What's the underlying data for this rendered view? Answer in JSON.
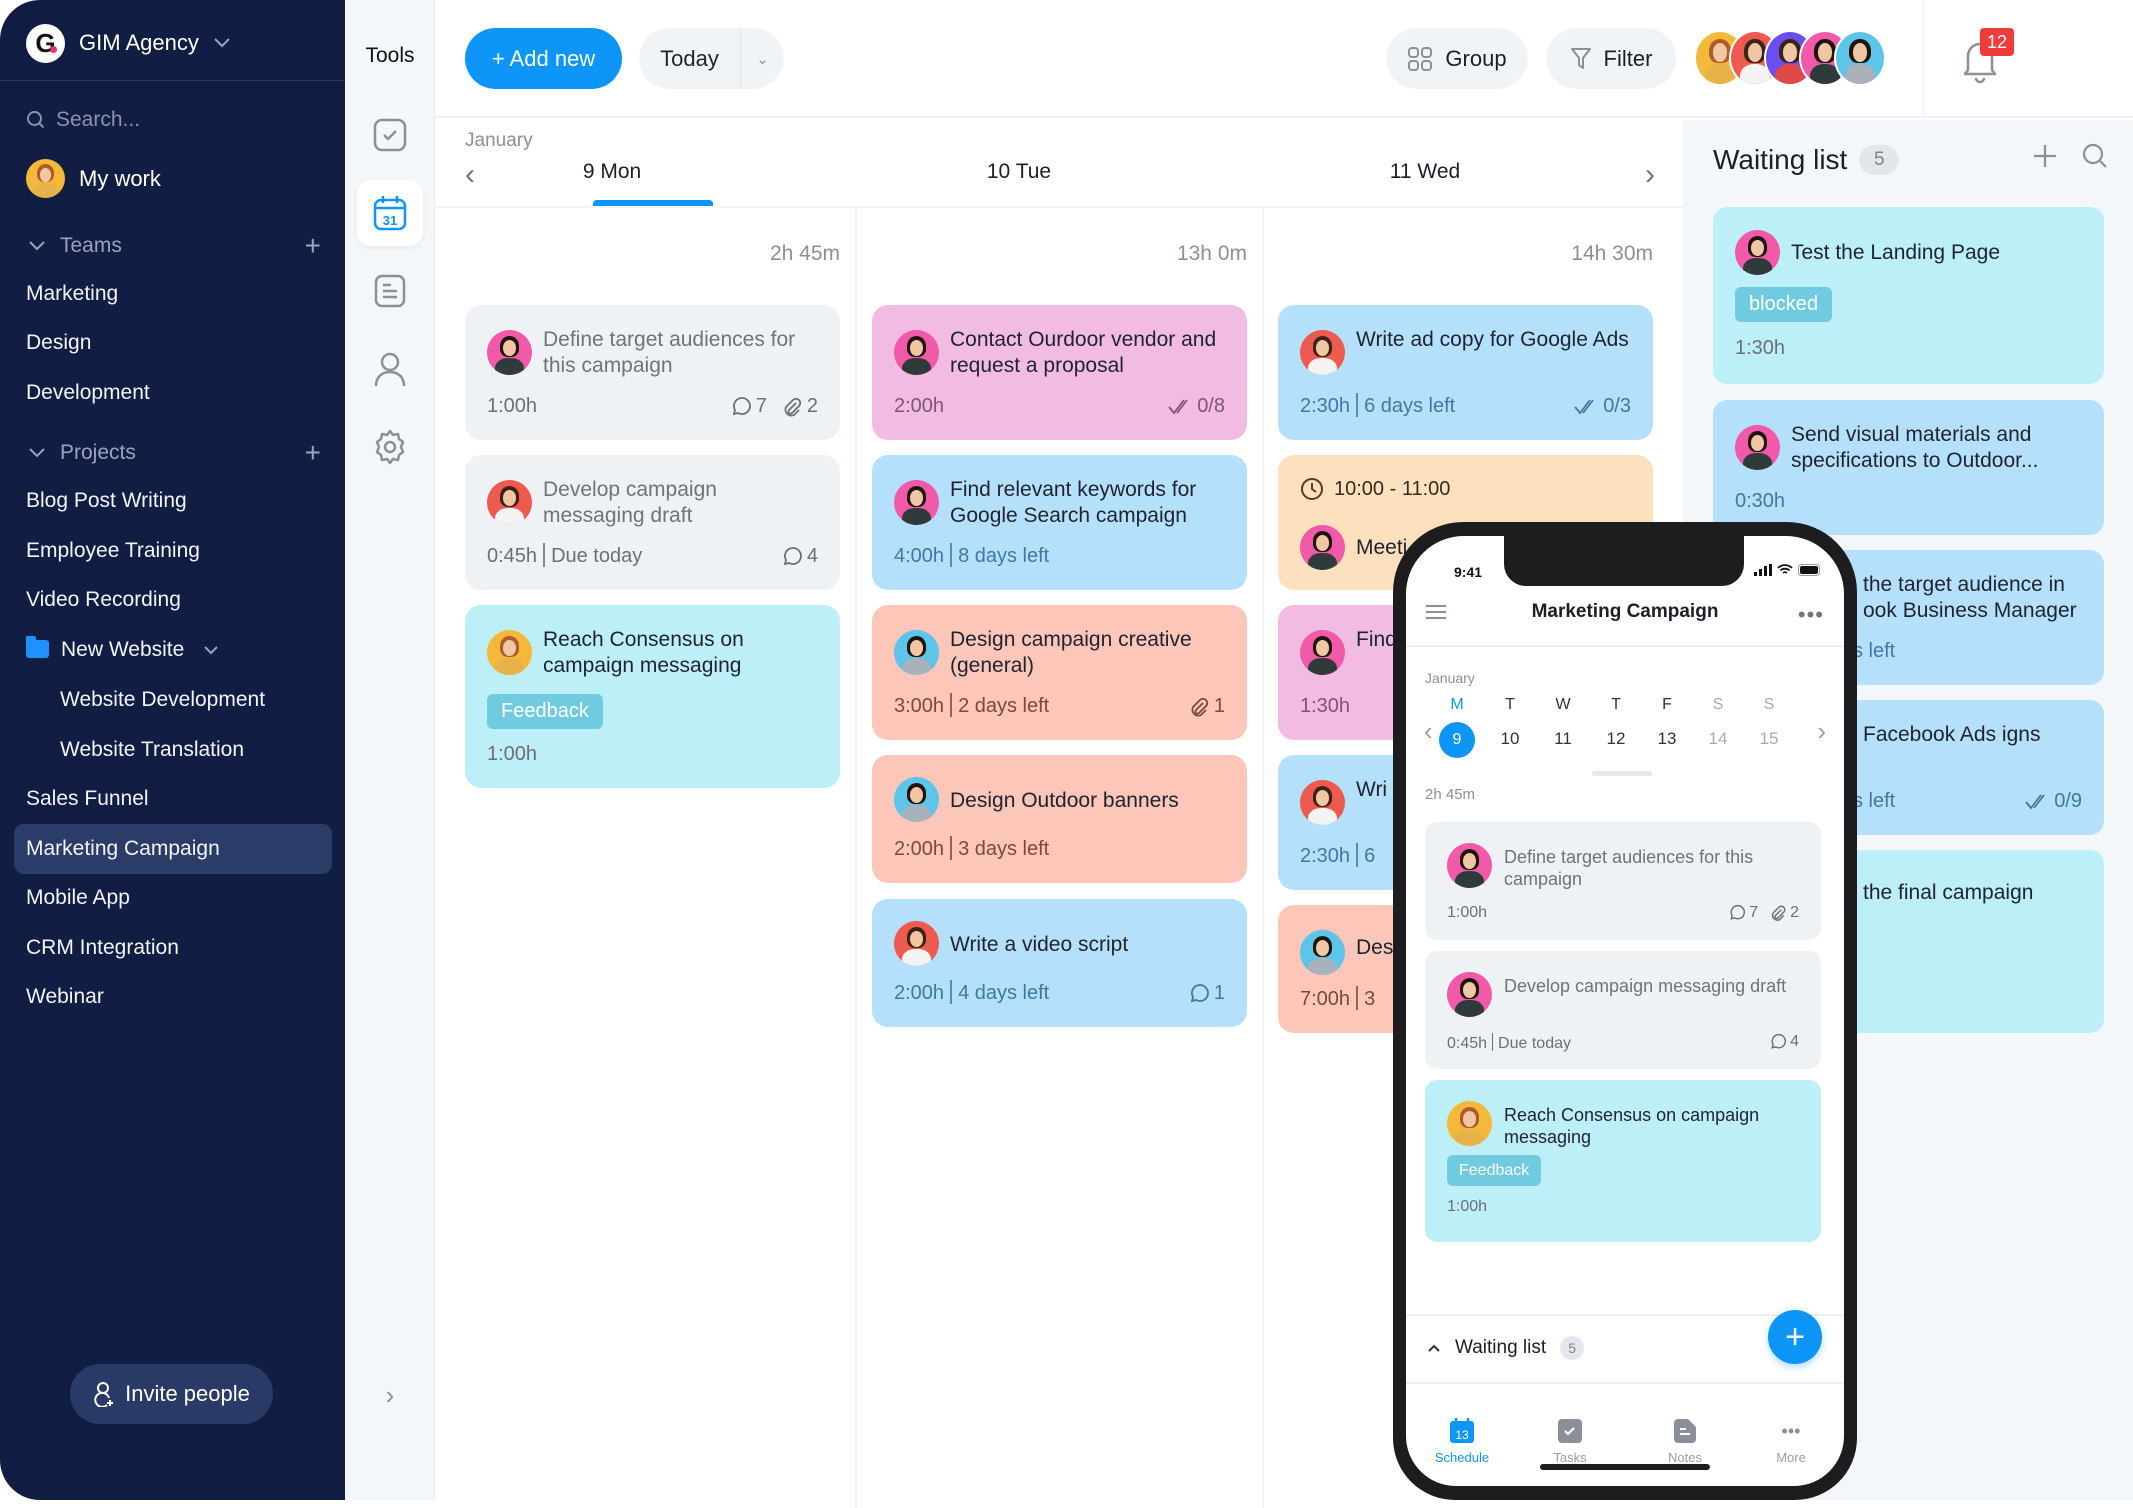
{
  "sidebar": {
    "workspace": "GIM Agency",
    "logo_letter": "G",
    "search_placeholder": "Search...",
    "my_work": "My work",
    "teams_label": "Teams",
    "teams": [
      "Marketing",
      "Design",
      "Development"
    ],
    "projects_label": "Projects",
    "projects": [
      "Blog Post Writing",
      "Employee Training",
      "Video Recording"
    ],
    "folder": {
      "label": "New Website",
      "children": [
        "Website Development",
        "Website Translation"
      ]
    },
    "projects_after": [
      "Sales Funnel",
      "Marketing Campaign",
      "Mobile App",
      "CRM Integration",
      "Webinar"
    ],
    "active_project": "Marketing Campaign",
    "invite": "Invite people"
  },
  "tools": {
    "title": "Tools",
    "items": [
      "tasks-icon",
      "calendar-icon",
      "notes-icon",
      "people-icon",
      "settings-icon"
    ],
    "calendar_day": "31"
  },
  "header": {
    "add_new": "+ Add new",
    "today": "Today",
    "group": "Group",
    "filter": "Filter",
    "notifications": "12"
  },
  "calendar": {
    "month": "January",
    "days": [
      {
        "label": "9 Mon",
        "total": "2h 45m",
        "active": true
      },
      {
        "label": "10 Tue",
        "total": "13h 0m"
      },
      {
        "label": "11 Wed",
        "total": "14h 30m"
      }
    ],
    "columns": [
      [
        {
          "title": "Define target audiences for this campaign",
          "meta": [
            "1:00h"
          ],
          "comments": "7",
          "attachments": "2",
          "color": "gray"
        },
        {
          "title": "Develop campaign messaging draft",
          "meta": [
            "0:45h",
            "Due today"
          ],
          "comments": "4",
          "color": "gray"
        },
        {
          "title": "Reach Consensus on campaign messaging",
          "tag": "Feedback",
          "meta": [
            "1:00h"
          ],
          "color": "cyan"
        }
      ],
      [
        {
          "title": "Contact Ourdoor vendor and request a proposal",
          "meta": [
            "2:00h"
          ],
          "checklist": "0/8",
          "color": "pink"
        },
        {
          "title": "Find relevant keywords for Google Search campaign",
          "meta": [
            "4:00h",
            "8 days left"
          ],
          "color": "blue"
        },
        {
          "title": "Design campaign creative (general)",
          "meta": [
            "3:00h",
            "2 days left"
          ],
          "attachments": "1",
          "color": "salmon"
        },
        {
          "title": "Design Outdoor banners",
          "meta": [
            "2:00h",
            "3 days left"
          ],
          "color": "salmon"
        },
        {
          "title": "Write a video script",
          "meta": [
            "2:00h",
            "4 days left"
          ],
          "comments": "1",
          "color": "blue"
        }
      ],
      [
        {
          "title": "Write ad copy for Google Ads",
          "meta": [
            "2:30h",
            "6 days left"
          ],
          "checklist": "0/3",
          "color": "blue"
        },
        {
          "time": "10:00 - 11:00",
          "title": "Meeti",
          "color": "peach"
        },
        {
          "title": "Find com",
          "meta": [
            "1:30h"
          ],
          "color": "pink"
        },
        {
          "title": "Wri Fac",
          "meta": [
            "2:30h",
            "6"
          ],
          "color": "blue"
        },
        {
          "title": "Des",
          "meta": [
            "7:00h",
            "3"
          ],
          "color": "salmon"
        }
      ]
    ]
  },
  "waiting_list": {
    "title": "Waiting list",
    "count": "5",
    "items": [
      {
        "title": "Test the Landing Page",
        "tag": "blocked",
        "meta": "1:30h"
      },
      {
        "title": "Send visual materials and specifications to Outdoor...",
        "meta": "0:30h"
      },
      {
        "title": "the target audience in ook Business Manager",
        "meta": "s left"
      },
      {
        "title": "Facebook Ads igns",
        "meta": "s left",
        "checklist": "0/9"
      },
      {
        "title": "the final campaign"
      }
    ]
  },
  "phone": {
    "time": "9:41",
    "title": "Marketing Campaign",
    "month": "January",
    "weekdays": [
      "M",
      "T",
      "W",
      "T",
      "F",
      "S",
      "S"
    ],
    "dates": [
      "9",
      "10",
      "11",
      "12",
      "13",
      "14",
      "15"
    ],
    "selected": "9",
    "total": "2h 45m",
    "cards": [
      {
        "title": "Define target audiences for this campaign",
        "meta": "1:00h",
        "comments": "7",
        "attachments": "2"
      },
      {
        "title": "Develop campaign messaging draft",
        "meta": "0:45h",
        "due": "Due today",
        "comments": "4"
      },
      {
        "title": "Reach Consensus on campaign messaging",
        "tag": "Feedback",
        "meta": "1:00h"
      }
    ],
    "waiting_label": "Waiting list",
    "waiting_count": "5",
    "tabs": [
      "Schedule",
      "Tasks",
      "Notes",
      "More"
    ],
    "schedule_day": "13"
  },
  "colors": {
    "accent": "#0d95f7",
    "sidebar": "#111d43",
    "badge": "#ee3b3b"
  }
}
